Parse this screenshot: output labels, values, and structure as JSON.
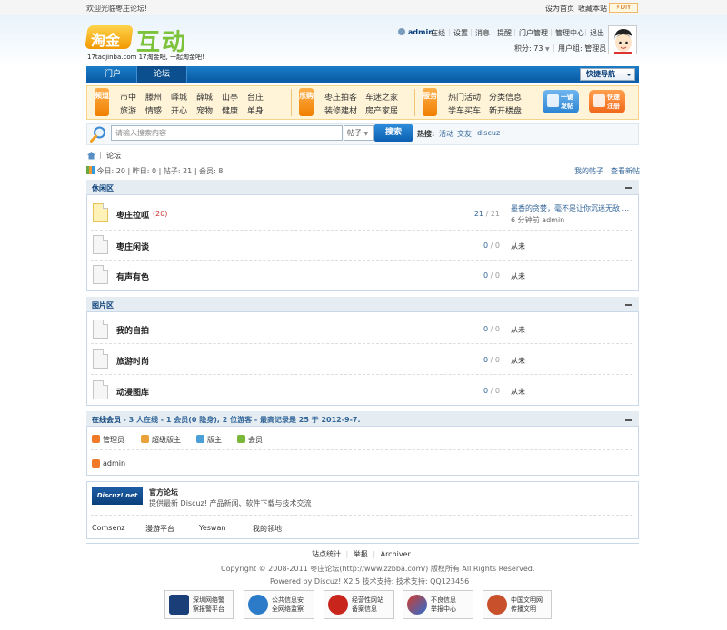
{
  "topbar": {
    "welcome": "欢迎光临枣庄论坛!",
    "sethome": "设为首页",
    "favorite": "收藏本站",
    "diy": "DIY"
  },
  "logo": {
    "badge_text": "淘金",
    "main_text": "互动",
    "sub_text": "17taojinba.com 17淘金吧, 一起淘金吧!"
  },
  "user": {
    "name": "admin",
    "online": "在线",
    "menu": [
      "设置",
      "消息",
      "提醒",
      "门户管理",
      "管理中心",
      "退出"
    ],
    "score_label": "积分: 73",
    "group_label": "用户组: 管理员"
  },
  "nav": {
    "tabs": [
      "门户",
      "论坛"
    ],
    "quick": "快捷导航"
  },
  "subnav": {
    "groups": [
      {
        "tag": "频道",
        "links": [
          "市中",
          "滕州",
          "峄城",
          "薛城",
          "山亭",
          "台庄",
          "旅游",
          "情感",
          "开心",
          "宠物",
          "健康",
          "单身"
        ]
      },
      {
        "tag": "乐购",
        "links": [
          "枣庄拍客",
          "车迷之家",
          "装修建材",
          "房产家居"
        ]
      },
      {
        "tag": "服务",
        "links": [
          "热门活动",
          "分类信息",
          "学车买车",
          "新开楼盘"
        ]
      }
    ],
    "post_btn": [
      "一键",
      "发帖"
    ],
    "register_btn": [
      "快速",
      "注册"
    ]
  },
  "search": {
    "placeholder": "请输入搜索内容",
    "type": "帖子",
    "button": "搜索",
    "hot_label": "热搜:",
    "hot_words": [
      "活动",
      "交友",
      "discuz"
    ]
  },
  "breadcrumb": {
    "sep": "|",
    "current": "论坛"
  },
  "stats": {
    "text": "今日: 20 | 昨日: 0 | 帖子: 21 | 会员: 8",
    "my_threads": "我的帖子",
    "new_threads": "查看新帖"
  },
  "sections": [
    {
      "title": "休闲区",
      "forums": [
        {
          "name": "枣庄拉呱",
          "today": "(20)",
          "threads": "21",
          "posts": "21",
          "last_title": "墨香的贪婪，毫不是让你沉迷无敌 ...",
          "last_time": "6 分钟前 admin",
          "new": true
        },
        {
          "name": "枣庄闲谈",
          "today": "",
          "threads": "0",
          "posts": "0",
          "last_title": "从未",
          "last_time": "",
          "new": false
        },
        {
          "name": "有声有色",
          "today": "",
          "threads": "0",
          "posts": "0",
          "last_title": "从未",
          "last_time": "",
          "new": false
        }
      ]
    },
    {
      "title": "图片区",
      "forums": [
        {
          "name": "我的自拍",
          "today": "",
          "threads": "0",
          "posts": "0",
          "last_title": "从未",
          "last_time": "",
          "new": false
        },
        {
          "name": "旅游时尚",
          "today": "",
          "threads": "0",
          "posts": "0",
          "last_title": "从未",
          "last_time": "",
          "new": false
        },
        {
          "name": "动漫图库",
          "today": "",
          "threads": "0",
          "posts": "0",
          "last_title": "从未",
          "last_time": "",
          "new": false
        }
      ]
    }
  ],
  "online": {
    "label": "在线会员",
    "summary": "- 3 人在线 - 1 会员(0 隐身), 2 位游客 - 最高记录是 25 于 2012-9-7.",
    "roles": [
      {
        "name": "管理员",
        "color": "#f07a2a"
      },
      {
        "name": "超级版主",
        "color": "#e9a23a"
      },
      {
        "name": "版主",
        "color": "#4a9fd8"
      },
      {
        "name": "会员",
        "color": "#7ab83a"
      }
    ],
    "users": [
      "admin"
    ]
  },
  "links": {
    "official_logo": "Discuz!.net",
    "official_title": "官方论坛",
    "official_desc": "提供最新 Discuz! 产品新闻、软件下载与技术交流",
    "items": [
      "Comsenz",
      "漫游平台",
      "Yeswan",
      "我的领地"
    ]
  },
  "footer": {
    "links": [
      "站点统计",
      "举报",
      "Archiver"
    ],
    "copyright": "Copyright © 2008-2011 枣庄论坛(http://www.zzbba.com/) 版权所有 All Rights Reserved.",
    "powered": "Powered by Discuz! X2.5  技术支持: 技术支持: QQ123456",
    "badges": [
      {
        "l1": "深圳网络警",
        "l2": "察报警平台",
        "color": "#1a3e78"
      },
      {
        "l1": "公共信息安",
        "l2": "全网络监察",
        "color": "#2b7bc9"
      },
      {
        "l1": "经营性网站",
        "l2": "备案信息",
        "color": "#c8251d"
      },
      {
        "l1": "不良信息",
        "l2": "举报中心",
        "color": "#d23b2b"
      },
      {
        "l1": "中国文明网",
        "l2": "传播文明",
        "color": "#c8502b"
      }
    ]
  }
}
